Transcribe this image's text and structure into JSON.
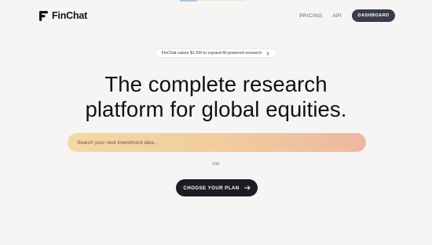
{
  "brand": {
    "name": "FinChat",
    "logo_icon": "finchat-logo-icon"
  },
  "nav": {
    "items": [
      {
        "label": "PRICING"
      },
      {
        "label": "API"
      }
    ],
    "dashboard_label": "DASHBOARD"
  },
  "announcement": {
    "text": "FinChat raises $1.5M to expand AI-powered research",
    "icon": "chevron-right-icon"
  },
  "hero": {
    "headline_line1": "The complete research",
    "headline_line2": "platform for global equities."
  },
  "search": {
    "placeholder": "Search your next investment idea..."
  },
  "divider_text": "OR",
  "cta": {
    "label": "CHOOSE YOUR PLAN",
    "icon": "arrow-right-icon"
  },
  "colors": {
    "background": "#f7f5f3",
    "dashboard_button": "#3a3c4e",
    "cta_button": "#1c1c22",
    "search_gradient_start": "#f3d9a4",
    "search_gradient_end": "#edb8a2"
  }
}
